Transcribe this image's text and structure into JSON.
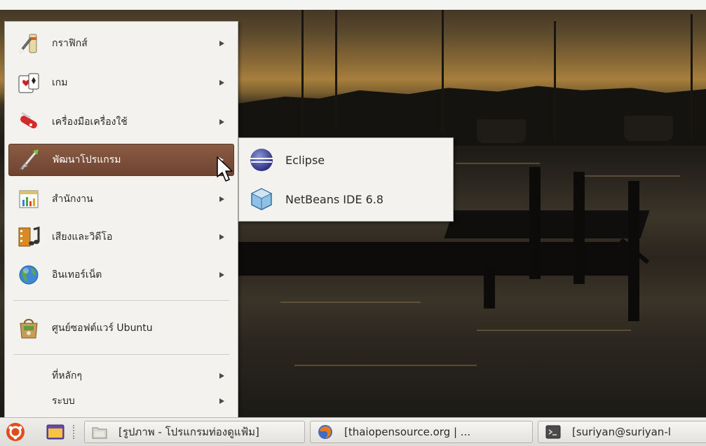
{
  "menu": {
    "items": [
      {
        "label": "กราฟิกส์",
        "icon": "graphics-icon",
        "has_submenu": true
      },
      {
        "label": "เกม",
        "icon": "games-icon",
        "has_submenu": true
      },
      {
        "label": "เครื่องมือเครื่องใช้",
        "icon": "accessories-icon",
        "has_submenu": true
      },
      {
        "label": "พัฒนาโปรแกรม",
        "icon": "programming-icon",
        "has_submenu": true,
        "active": true
      },
      {
        "label": "สำนักงาน",
        "icon": "office-icon",
        "has_submenu": true
      },
      {
        "label": "เสียงและวิดีโอ",
        "icon": "sound-video-icon",
        "has_submenu": true
      },
      {
        "label": "อินเทอร์เน็ต",
        "icon": "internet-icon",
        "has_submenu": true
      },
      {
        "label": "ศูนย์ซอฟต์แวร์ Ubuntu",
        "icon": "software-center-icon",
        "has_submenu": false
      },
      {
        "label": "ที่หลักๆ",
        "has_submenu": true
      },
      {
        "label": "ระบบ",
        "has_submenu": true
      }
    ]
  },
  "submenu": {
    "items": [
      {
        "label": "Eclipse",
        "icon": "eclipse-icon"
      },
      {
        "label": "NetBeans IDE 6.8",
        "icon": "netbeans-icon"
      }
    ]
  },
  "taskbar": {
    "menu_button_icon": "ubuntu-menu-icon",
    "show_desktop_icon": "show-desktop-icon",
    "windows": [
      {
        "label": "[รูปภาพ - โปรแกรมท่องดูแฟ้ม]",
        "icon": "file-browser-icon"
      },
      {
        "label": "[thaiopensource.org | ...",
        "icon": "firefox-icon"
      },
      {
        "label": "[suriyan@suriyan-l",
        "icon": "terminal-icon"
      }
    ]
  },
  "colors": {
    "menu_bg": "#f3f2ef",
    "active_item": "#7a4d39",
    "taskbar_bg": "#e6e4e0"
  }
}
